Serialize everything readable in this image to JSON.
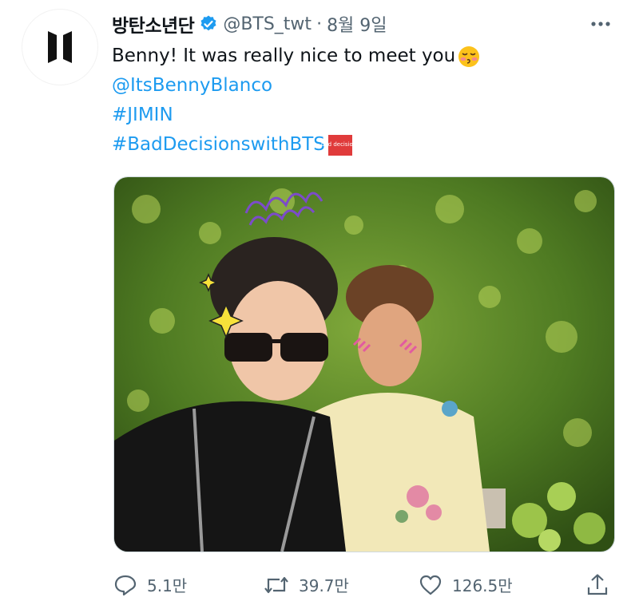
{
  "tweet": {
    "avatar_icon": "bts-logo-icon",
    "display_name": "방탄소년단",
    "handle": "@BTS_twt",
    "separator": "·",
    "date": "8월 9일",
    "text_main": "Benny! It was really nice to meet you",
    "emoji_name": "kissing-face-icon",
    "mention": "@ItsBennyBlanco",
    "hashtag1": "#JIMIN",
    "hashtag2": "#BadDecisionswithBTS",
    "badge_text": "bad decisions",
    "badge_color": "#e03b3b"
  },
  "actions": {
    "reply_count": "5.1만",
    "retweet_count": "39.7만",
    "like_count": "126.5만"
  },
  "colors": {
    "link": "#1d9bf0",
    "muted": "#536471",
    "verified": "#1d9bf0"
  }
}
